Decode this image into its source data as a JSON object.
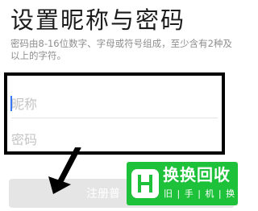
{
  "page": {
    "title": "设置昵称与密码",
    "description": "密码由8-16位数字、字母或符号组成，至少含有2种及以上的字符。"
  },
  "form": {
    "nickname_placeholder": "昵称",
    "password_placeholder": "密码",
    "register_label": "注册普"
  },
  "watermark": {
    "name": "换换回收",
    "tagline": "旧 | 手 | 机 | 换 | 钱"
  },
  "colors": {
    "accent": "#1ec13a",
    "button_disabled": "#e5e5e5"
  }
}
